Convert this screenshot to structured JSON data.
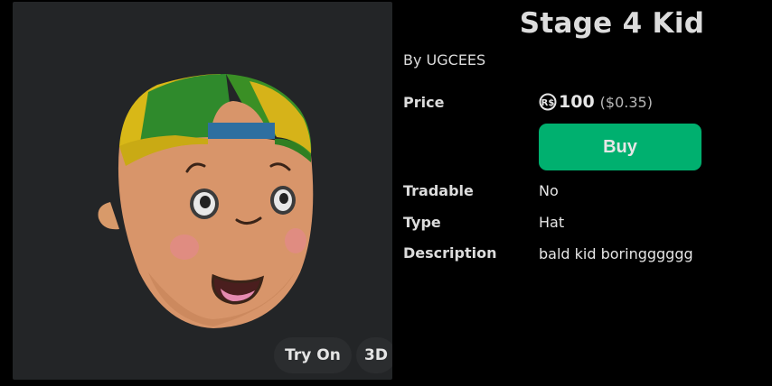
{
  "item": {
    "title": "Stage 4 Kid",
    "creator_prefix": "By ",
    "creator_name": "UGCEES"
  },
  "price": {
    "label": "Price",
    "currency_icon": "robux-icon",
    "amount": "100",
    "usd": "($0.35)"
  },
  "actions": {
    "buy_label": "Buy",
    "try_on_label": "Try On",
    "three_d_label": "3D"
  },
  "details": [
    {
      "label": "Tradable",
      "value": "No"
    },
    {
      "label": "Type",
      "value": "Hat"
    },
    {
      "label": "Description",
      "value": "bald kid boringggggg"
    }
  ],
  "colors": {
    "background": "#000000",
    "thumbnail_bg": "#232527",
    "buy_button": "#00b06f",
    "text": "#dcdcdc"
  }
}
